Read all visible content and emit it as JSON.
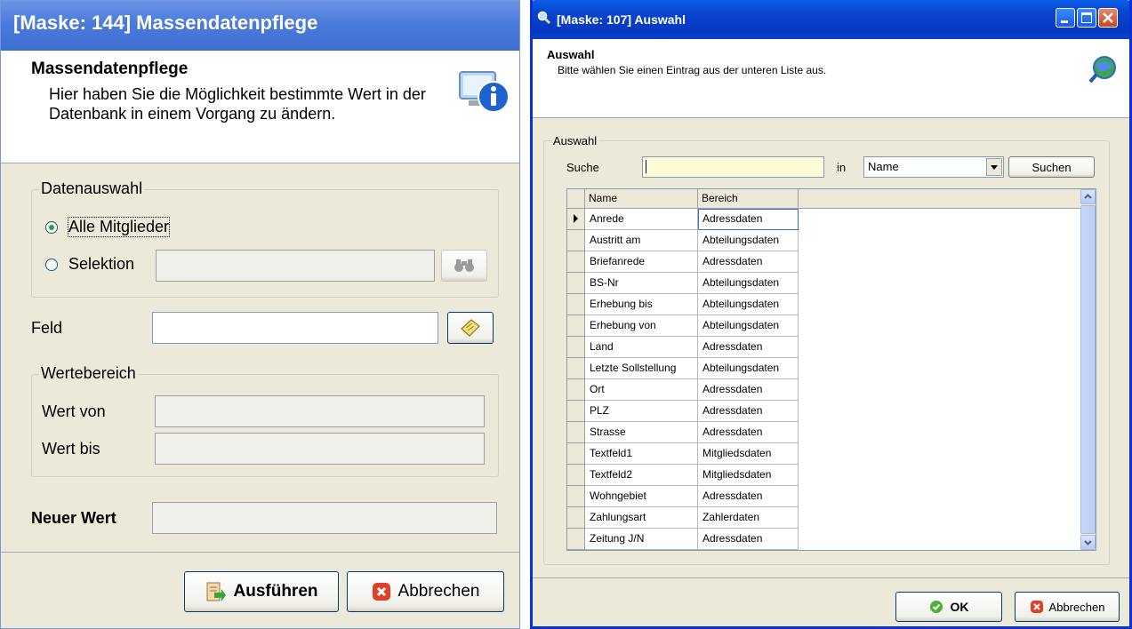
{
  "left": {
    "title": "[Maske: 144]  Massendatenpflege",
    "header_title": "Massendatenpflege",
    "header_desc": "Hier haben Sie die Möglichkeit bestimmte Wert in der Datenbank in einem Vorgang zu ändern.",
    "datenauswahl": {
      "legend": "Datenauswahl",
      "option_all": "Alle Mitglieder",
      "option_selection": "Selektion",
      "selection_value": ""
    },
    "feld": {
      "label": "Feld",
      "value": ""
    },
    "wertebereich": {
      "legend": "Wertebereich",
      "von_label": "Wert von",
      "bis_label": "Wert bis"
    },
    "neuer_wert_label": "Neuer Wert",
    "btn_execute": "Ausführen",
    "btn_cancel": "Abbrechen"
  },
  "right": {
    "title": "[Maske: 107]  Auswahl",
    "header_title": "Auswahl",
    "header_desc": "Bitte wählen Sie einen Eintrag aus der unteren Liste aus.",
    "group_legend": "Auswahl",
    "search_label": "Suche",
    "search_value": "",
    "in_label": "in",
    "in_selected": "Name",
    "search_button": "Suchen",
    "columns": [
      "Name",
      "Bereich"
    ],
    "rows": [
      [
        "Anrede",
        "Adressdaten"
      ],
      [
        "Austritt am",
        "Abteilungsdaten"
      ],
      [
        "Briefanrede",
        "Adressdaten"
      ],
      [
        "BS-Nr",
        "Abteilungsdaten"
      ],
      [
        "Erhebung bis",
        "Abteilungsdaten"
      ],
      [
        "Erhebung von",
        "Abteilungsdaten"
      ],
      [
        "Land",
        "Adressdaten"
      ],
      [
        "Letzte Sollstellung",
        "Abteilungsdaten"
      ],
      [
        "Ort",
        "Adressdaten"
      ],
      [
        "PLZ",
        "Adressdaten"
      ],
      [
        "Strasse",
        "Adressdaten"
      ],
      [
        "Textfeld1",
        "Mitgliedsdaten"
      ],
      [
        "Textfeld2",
        "Mitgliedsdaten"
      ],
      [
        "Wohngebiet",
        "Adressdaten"
      ],
      [
        "Zahlungsart",
        "Zahlerdaten"
      ],
      [
        "Zeitung J/N",
        "Adressdaten"
      ]
    ],
    "selected_row": 0,
    "btn_ok": "OK",
    "btn_cancel": "Abbrechen"
  }
}
